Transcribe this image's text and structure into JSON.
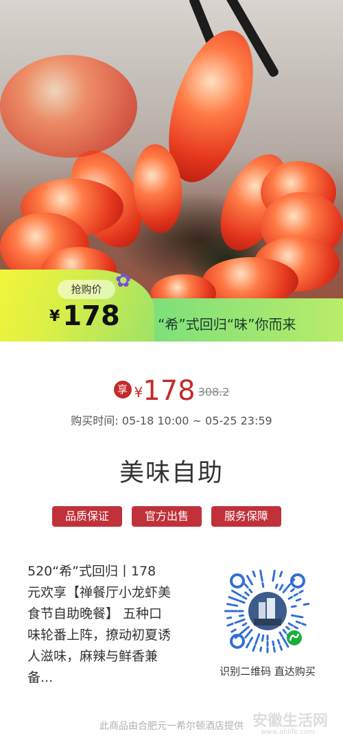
{
  "hero": {
    "price_tag_label": "抢购价",
    "currency": "¥",
    "price": "178",
    "slogan": "“希”式回归“味”你而来"
  },
  "price": {
    "enjoy_label": "享",
    "currency": "¥",
    "current": "178",
    "original": "308.2",
    "purchase_time_label": "购买时间:",
    "purchase_time_value": "05-18 10:00 ~ 05-25 23:59"
  },
  "product": {
    "title": "美味自助",
    "badges": [
      "品质保证",
      "官方出售",
      "服务保障"
    ],
    "description": [
      "520“希”式回归丨178",
      "元欢享【禅餐厅小龙虾美",
      "食节自助晚餐】 五种口",
      "味轮番上阵，撩动初夏诱",
      "人滋味，麻辣与鲜香兼",
      "备..."
    ]
  },
  "qr": {
    "label": "识别二维码 直达购买"
  },
  "footer": {
    "provider": "此商品由合肥元一希尔顿酒店提供",
    "watermark": "安徽生活网",
    "watermark_url": "www.ahlife.com"
  },
  "colors": {
    "accent_red": "#c42a2a",
    "badge_red": "#c1313a",
    "ribbon_green": "#7ee07a",
    "ribbon_yellow": "#f2f53a"
  }
}
